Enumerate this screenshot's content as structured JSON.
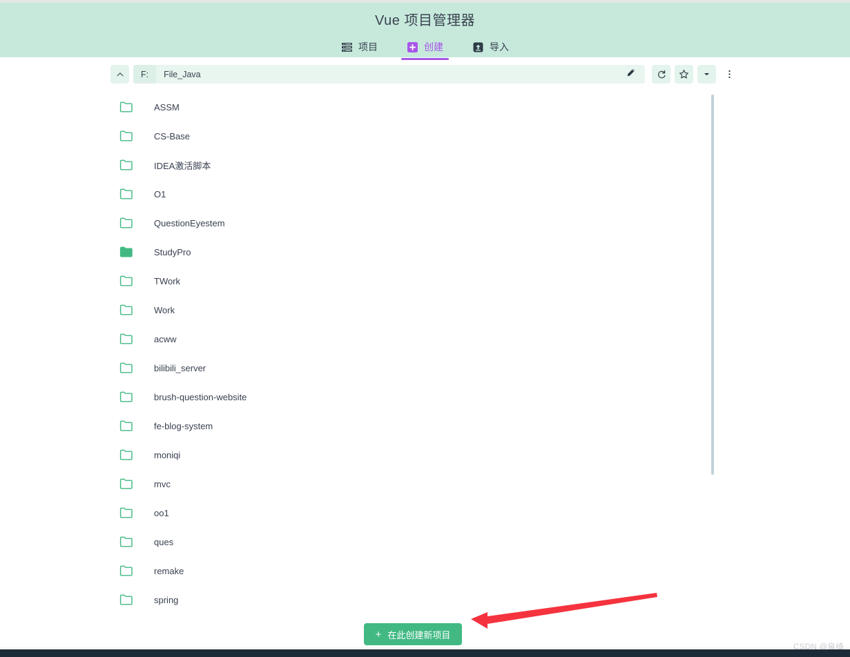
{
  "header": {
    "title": "Vue 项目管理器",
    "tabs": [
      {
        "label": "项目",
        "icon": "list-icon",
        "active": false
      },
      {
        "label": "创建",
        "icon": "plus-square-icon",
        "active": true
      },
      {
        "label": "导入",
        "icon": "import-box-icon",
        "active": false
      }
    ]
  },
  "toolbar": {
    "collapse_icon": "chevron-up-icon",
    "breadcrumb": {
      "root": "F:",
      "segments": [
        "File_Java"
      ],
      "edit_icon": "pencil-icon"
    },
    "buttons": [
      {
        "name": "refresh-button",
        "icon": "refresh-icon"
      },
      {
        "name": "favorite-button",
        "icon": "star-icon"
      },
      {
        "name": "dropdown-button",
        "icon": "chevron-down-icon"
      },
      {
        "name": "more-menu-button",
        "icon": "kebab-menu-icon"
      }
    ]
  },
  "file_list": [
    {
      "name": "ASSM",
      "icon": "folder-outline-icon",
      "selected": false
    },
    {
      "name": "CS-Base",
      "icon": "folder-outline-icon",
      "selected": false
    },
    {
      "name": "IDEA激活脚本",
      "icon": "folder-outline-icon",
      "selected": false
    },
    {
      "name": "O1",
      "icon": "folder-outline-icon",
      "selected": false
    },
    {
      "name": "QuestionEyestem",
      "icon": "folder-outline-icon",
      "selected": false
    },
    {
      "name": "StudyPro",
      "icon": "folder-filled-icon",
      "selected": true
    },
    {
      "name": "TWork",
      "icon": "folder-outline-icon",
      "selected": false
    },
    {
      "name": "Work",
      "icon": "folder-outline-icon",
      "selected": false
    },
    {
      "name": "acww",
      "icon": "folder-outline-icon",
      "selected": false
    },
    {
      "name": "bilibili_server",
      "icon": "folder-outline-icon",
      "selected": false
    },
    {
      "name": "brush-question-website",
      "icon": "folder-outline-icon",
      "selected": false
    },
    {
      "name": "fe-blog-system",
      "icon": "folder-outline-icon",
      "selected": false
    },
    {
      "name": "moniqi",
      "icon": "folder-outline-icon",
      "selected": false
    },
    {
      "name": "mvc",
      "icon": "folder-outline-icon",
      "selected": false
    },
    {
      "name": "oo1",
      "icon": "folder-outline-icon",
      "selected": false
    },
    {
      "name": "ques",
      "icon": "folder-outline-icon",
      "selected": false
    },
    {
      "name": "remake",
      "icon": "folder-outline-icon",
      "selected": false
    },
    {
      "name": "spring",
      "icon": "folder-outline-icon",
      "selected": false
    }
  ],
  "footer": {
    "create_button_label": "在此创建新项目",
    "create_button_plus": "+",
    "annotation_arrow": "red-left-arrow"
  },
  "watermark": "CSDN @泉绮",
  "colors": {
    "header_bg": "#c6e9dc",
    "accent_purple": "#a855e8",
    "accent_green": "#42b983",
    "folder_green": "#42b983",
    "text_dark": "#394150",
    "annotation_red": "#f5333f",
    "bottom_bar": "#1d2a38"
  }
}
